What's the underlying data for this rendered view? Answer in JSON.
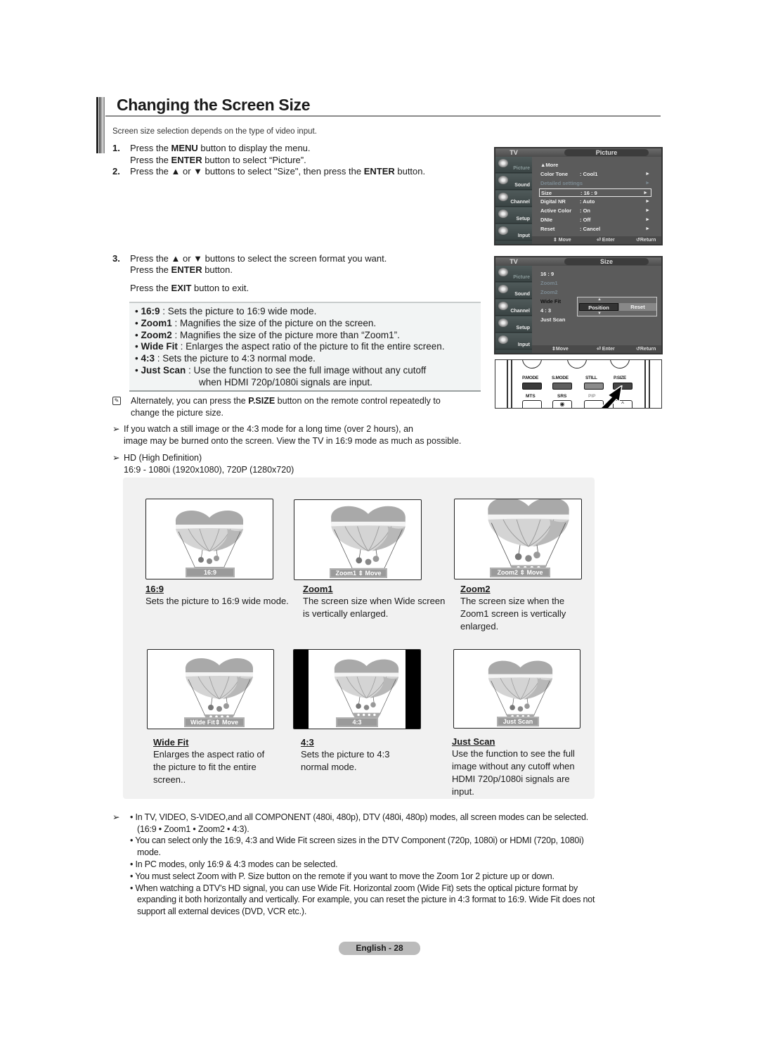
{
  "page": {
    "title": "Changing the Screen Size",
    "subtitle": "Screen size selection depends on the type of video input.",
    "footer": "English - 28"
  },
  "steps": [
    {
      "num": "1.",
      "lines": [
        {
          "pre": "Press the ",
          "bold": "MENU",
          "post": " button to display the menu."
        },
        {
          "pre": "Press the ",
          "bold": "ENTER",
          "post": " button to select “Picture”."
        }
      ]
    },
    {
      "num": "2.",
      "lines": [
        {
          "pre": "Press the ▲ or ▼ buttons to select \"Size\",  then press the ",
          "bold": "ENTER",
          "post": " button."
        }
      ]
    },
    {
      "num": "3.",
      "lines": [
        {
          "pre": "Press the ▲ or ▼ buttons to select the screen format you want.",
          "bold": "",
          "post": ""
        },
        {
          "pre": "Press the ",
          "bold": "ENTER",
          "post": " button."
        },
        {
          "pre": "Press the ",
          "bold": "EXIT",
          "post": " button to exit."
        }
      ]
    }
  ],
  "modes": [
    {
      "name": "16:9",
      "desc": " : Sets the picture to 16:9 wide mode."
    },
    {
      "name": "Zoom1",
      "desc": " : Magnifies the size of the picture on the screen."
    },
    {
      "name": "Zoom2",
      "desc": " : Magnifies the size of the picture more than “Zoom1”."
    },
    {
      "name": "Wide Fit",
      "desc": " : Enlarges the aspect ratio of the picture to fit the entire screen."
    },
    {
      "name": "4:3",
      "desc": " : Sets the picture to 4:3 normal mode."
    },
    {
      "name": "Just Scan",
      "desc": " : Use the function to see the full image without any cutoff",
      "cont": "when HDMI 720p/1080i signals are input."
    }
  ],
  "notes": {
    "psize_pre": "Alternately, you can press the ",
    "psize_bold": "P.SIZE",
    "psize_post": " button on the remote control repeatedly to",
    "psize_line2": "change the picture size.",
    "burn_line1": "If you watch a still image or the 4:3 mode for a long time (over 2 hours), an",
    "burn_line2": "image may be burned onto the screen. View the TV in 16:9 mode as much as possible.",
    "hd_line1": "HD (High Definition)",
    "hd_line2": "16:9 - 1080i (1920x1080), 720P (1280x720)"
  },
  "osd_picture": {
    "tv": "TV",
    "title": "Picture",
    "sidebar": [
      "Picture",
      "Sound",
      "Channel",
      "Setup",
      "Input"
    ],
    "rows": [
      {
        "key": "▲More",
        "value": "",
        "arrow": "",
        "state": "normal"
      },
      {
        "key": "Color Tone",
        "value": ": Cool1",
        "arrow": "►",
        "state": "normal"
      },
      {
        "key": "Detailed settings",
        "value": "",
        "arrow": "►",
        "state": "disabled"
      },
      {
        "key": "Size",
        "value": ": 16 : 9",
        "arrow": "►",
        "state": "selected"
      },
      {
        "key": "Digital NR",
        "value": ": Auto",
        "arrow": "►",
        "state": "normal"
      },
      {
        "key": "Active Color",
        "value": ": On",
        "arrow": "►",
        "state": "normal"
      },
      {
        "key": "DNIe",
        "value": ": Off",
        "arrow": "►",
        "state": "normal"
      },
      {
        "key": "Reset",
        "value": ": Cancel",
        "arrow": "►",
        "state": "normal"
      }
    ],
    "footer": {
      "move": "⇕ Move",
      "enter": "⏎ Enter",
      "return": "↺Return"
    }
  },
  "osd_size": {
    "tv": "TV",
    "title": "Size",
    "sidebar": [
      "Picture",
      "Sound",
      "Channel",
      "Setup",
      "Input"
    ],
    "rows": [
      {
        "key": "16 : 9",
        "state": "normal"
      },
      {
        "key": "Zoom1",
        "state": "disabled"
      },
      {
        "key": "Zoom2",
        "state": "disabled"
      },
      {
        "key": "Wide Fit",
        "state": "active"
      },
      {
        "key": "4 : 3",
        "state": "normal"
      },
      {
        "key": "Just Scan",
        "state": "normal"
      }
    ],
    "position": "Position",
    "reset": "Reset",
    "footer": {
      "move": "⇕Move",
      "enter": "⏎ Enter",
      "return": "↺Return"
    }
  },
  "remote": {
    "top_buttons": [
      {
        "label": "P.MODE",
        "color": "#3a3a3a"
      },
      {
        "label": "S.MODE",
        "color": "#5e5e5e"
      },
      {
        "label": "STILL",
        "color": "#8a8a8a"
      },
      {
        "label": "P.SIZE",
        "color": "#444444"
      }
    ],
    "bottom_labels": [
      "MTS",
      "SRS",
      "PIP"
    ]
  },
  "illustrations": [
    {
      "label": "16:9",
      "bar": "16:9",
      "desc": "Sets the picture to 16:9 wide mode."
    },
    {
      "label": "Zoom1",
      "bar": "Zoom1 ⇕ Move",
      "desc": "The screen size when Wide screen\nis vertically enlarged."
    },
    {
      "label": "Zoom2",
      "bar": "Zoom2 ⇕ Move",
      "desc": "The screen size when the\nZoom1 screen is vertically\nenlarged."
    },
    {
      "label": "Wide Fit",
      "bar": "Wide Fit⇕ Move",
      "desc": "Enlarges the aspect ratio of\nthe picture to fit the entire\nscreen.."
    },
    {
      "label": "4:3",
      "bar": "4:3",
      "desc": "Sets the picture to 4:3\nnormal mode."
    },
    {
      "label": "Just Scan",
      "bar": "Just Scan",
      "desc": "Use the function to see the full\nimage without any cutoff when\nHDMI 720p/1080i signals are\ninput."
    }
  ],
  "bottom_notes": [
    "• In TV, VIDEO, S-VIDEO,and all COMPONENT (480i, 480p), DTV (480i, 480p) modes, all screen modes can be selected.",
    "(16:9 • Zoom1 • Zoom2 • 4:3).",
    "• You can select only the 16:9, 4:3 and Wide Fit screen sizes in the DTV Component (720p, 1080i) or HDMI (720p, 1080i)",
    "mode.",
    "• In PC modes, only 16:9 & 4:3 modes can be selected.",
    "• You must select Zoom with P. Size button on the remote if you want to move the Zoom 1or 2 picture up or down.",
    "• When watching a DTV’s HD signal, you can use Wide Fit. Horizontal zoom (Wide Fit) sets the optical picture format by",
    "expanding it both horizontally and vertically. For example, you can reset the picture in 4:3 format to 16:9. Wide Fit does not",
    "support all external devices (DVD, VCR etc.)."
  ]
}
